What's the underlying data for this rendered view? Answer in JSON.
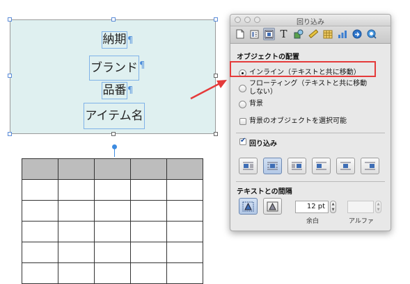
{
  "document": {
    "chips": [
      "納期",
      "ブランド",
      "品番",
      "アイテム名"
    ],
    "pilcrow": "¶"
  },
  "panel": {
    "title": "回り込み",
    "object_placement_title": "オブジェクトの配置",
    "placement_options": [
      {
        "label": "インライン（テキストと共に移動）",
        "selected": true
      },
      {
        "label_line1": "フローティング（テキストと共に移動",
        "label_line2": "しない）",
        "selected": false
      },
      {
        "label": "背景",
        "selected": false
      }
    ],
    "background_select_label": "背景のオブジェクトを選択可能",
    "background_select_checked": false,
    "wrap_label": "回り込み",
    "wrap_checked": true,
    "text_spacing_title": "テキストとの間隔",
    "spacing_value": "12 pt",
    "spacing_label": "余白",
    "alpha_value": "",
    "alpha_label": "アルファ",
    "toolbar_icons": [
      "document-icon",
      "layout-icon",
      "wrap-icon",
      "text-icon",
      "graphic-icon",
      "metrics-icon",
      "table-icon",
      "chart-icon",
      "hyperlink-icon",
      "quicktime-icon"
    ],
    "active_tool_index": 2
  }
}
